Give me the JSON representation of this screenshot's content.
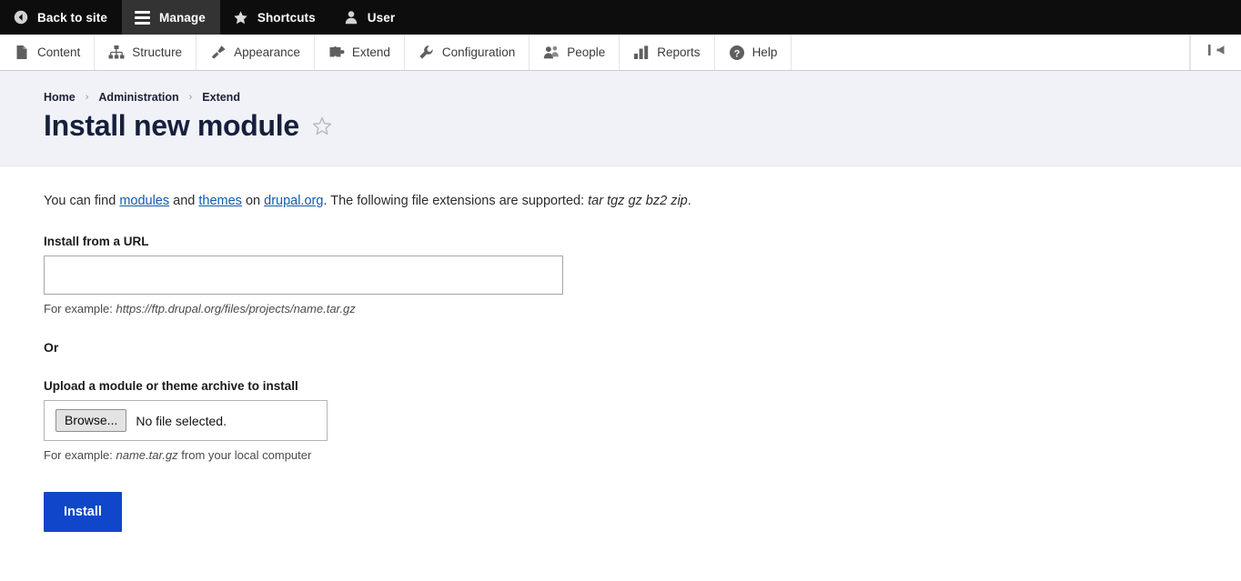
{
  "toolbar_top": {
    "items": [
      {
        "label": "Back to site",
        "icon": "back-arrow-circle-icon",
        "active": false
      },
      {
        "label": "Manage",
        "icon": "hamburger-icon",
        "active": true
      },
      {
        "label": "Shortcuts",
        "icon": "star-icon",
        "active": false
      },
      {
        "label": "User",
        "icon": "user-icon",
        "active": false
      }
    ]
  },
  "toolbar_sub": {
    "items": [
      {
        "label": "Content",
        "icon": "page-icon"
      },
      {
        "label": "Structure",
        "icon": "sitemap-icon"
      },
      {
        "label": "Appearance",
        "icon": "paintbrush-icon"
      },
      {
        "label": "Extend",
        "icon": "puzzle-piece-icon"
      },
      {
        "label": "Configuration",
        "icon": "wrench-icon"
      },
      {
        "label": "People",
        "icon": "people-icon"
      },
      {
        "label": "Reports",
        "icon": "bar-chart-icon"
      },
      {
        "label": "Help",
        "icon": "question-mark-circle-icon"
      }
    ],
    "collapse_icon": "collapse-toolbar-icon"
  },
  "header": {
    "breadcrumb": [
      {
        "label": "Home"
      },
      {
        "label": "Administration"
      },
      {
        "label": "Extend"
      }
    ],
    "breadcrumb_separator": "›",
    "title": "Install new module",
    "favorite_icon": "star-outline-icon"
  },
  "main": {
    "intro": {
      "part1": "You can find ",
      "link_modules": "modules",
      "part2": " and ",
      "link_themes": "themes",
      "part3": " on ",
      "link_drupal": "drupal.org",
      "part4": ". The following file extensions are supported: ",
      "extensions": "tar tgz gz bz2 zip",
      "part5": "."
    },
    "url_field": {
      "label": "Install from a URL",
      "value": "",
      "placeholder": "",
      "help_prefix": "For example: ",
      "help_example": "https://ftp.drupal.org/files/projects/name.tar.gz"
    },
    "or_label": "Or",
    "upload_field": {
      "label": "Upload a module or theme archive to install",
      "browse_label": "Browse...",
      "file_status": "No file selected.",
      "help_prefix": "For example: ",
      "help_example": "name.tar.gz",
      "help_suffix": " from your local computer"
    },
    "submit_label": "Install"
  },
  "colors": {
    "toolbar_top_bg": "#0d0d0d",
    "toolbar_active_bg": "#333333",
    "header_bg": "#f1f2f7",
    "title_color": "#16203c",
    "link_color": "#0f5ab0",
    "button_bg": "#1046c9"
  }
}
